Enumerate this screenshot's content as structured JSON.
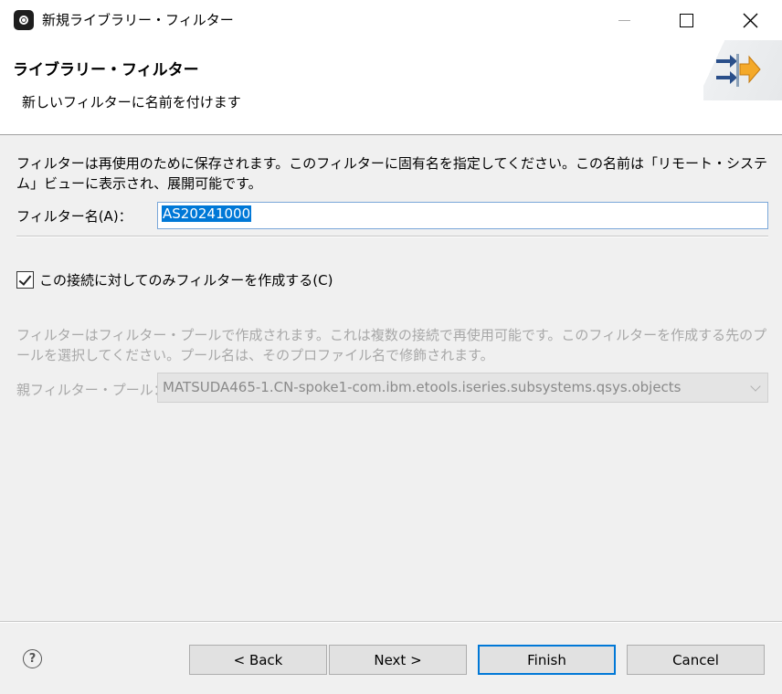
{
  "window": {
    "title": "新規ライブラリー・フィルター",
    "icon": "eclipse-app-icon"
  },
  "header": {
    "title": "ライブラリー・フィルター",
    "description": "新しいフィルターに名前を付けます",
    "icon": "wizard-arrows-icon"
  },
  "name_section": {
    "description": "フィルターは再使用のために保存されます。このフィルターに固有名を指定してください。この名前は「リモート・システム」ビューに表示され、展開可能です。",
    "label": "フィルター名(A)：",
    "value": "AS20241000"
  },
  "checkbox": {
    "label": "この接続に対してのみフィルターを作成する(C)",
    "checked": true
  },
  "pool_section": {
    "description": "フィルターはフィルター・プールで作成されます。これは複数の接続で再使用可能です。このフィルターを作成する先のプールを選択してください。プール名は、そのプロファイル名で修飾されます。",
    "label": "親フィルター・プール：",
    "selected": "MATSUDA465-1.CN-spoke1-com.ibm.etools.iseries.subsystems.qsys.objects",
    "enabled": false
  },
  "footer": {
    "help_icon": "?",
    "back": "< Back",
    "next": "Next >",
    "finish": "Finish",
    "cancel": "Cancel"
  },
  "colors": {
    "selection": "#0078d7",
    "dialog_bg": "#f0f0f0",
    "disabled_text": "#a8a8a8"
  }
}
